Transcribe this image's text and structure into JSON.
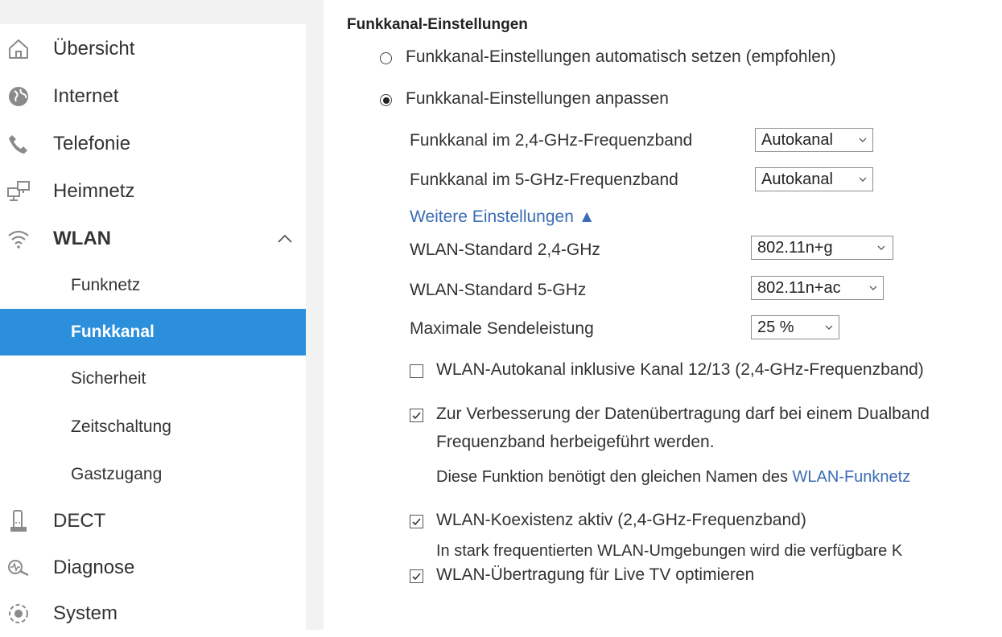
{
  "sidebar": {
    "items": [
      {
        "label": "Übersicht",
        "icon": "home-icon"
      },
      {
        "label": "Internet",
        "icon": "globe-icon"
      },
      {
        "label": "Telefonie",
        "icon": "phone-icon"
      },
      {
        "label": "Heimnetz",
        "icon": "network-icon"
      },
      {
        "label": "WLAN",
        "icon": "wifi-icon",
        "expanded": true
      },
      {
        "label": "DECT",
        "icon": "dect-phone-icon"
      },
      {
        "label": "Diagnose",
        "icon": "diagnose-icon"
      },
      {
        "label": "System",
        "icon": "system-icon"
      }
    ],
    "wlan_subitems": [
      {
        "label": "Funknetz"
      },
      {
        "label": "Funkkanal",
        "active": true
      },
      {
        "label": "Sicherheit"
      },
      {
        "label": "Zeitschaltung"
      },
      {
        "label": "Gastzugang"
      }
    ],
    "active_color": "#2b8fdc"
  },
  "content": {
    "section_title": "Funkkanal-Einstellungen",
    "radio_auto": {
      "label": "Funkkanal-Einstellungen automatisch setzen (empfohlen)",
      "checked": false
    },
    "radio_custom": {
      "label": "Funkkanal-Einstellungen anpassen",
      "checked": true
    },
    "channel_24": {
      "label": "Funkkanal im 2,4-GHz-Frequenzband",
      "value": "Autokanal"
    },
    "channel_5": {
      "label": "Funkkanal im 5-GHz-Frequenzband",
      "value": "Autokanal"
    },
    "more_settings": {
      "label": "Weitere Einstellungen ▲"
    },
    "standard_24": {
      "label": "WLAN-Standard 2,4-GHz",
      "value": "802.11n+g"
    },
    "standard_5": {
      "label": "WLAN-Standard 5-GHz",
      "value": "802.11n+ac"
    },
    "tx_power": {
      "label": "Maximale Sendeleistung",
      "value": "25 %"
    },
    "cb_autochannel": {
      "label": "WLAN-Autokanal inklusive Kanal 12/13 (2,4-GHz-Frequenzband)",
      "checked": false
    },
    "cb_band_steering": {
      "label_line1": "Zur Verbesserung der Datenübertragung darf bei einem Dualband",
      "label_line2": "Frequenzband herbeigeführt werden.",
      "note_prefix": "Diese Funktion benötigt den gleichen Namen des ",
      "note_link": "WLAN-Funknetz",
      "checked": true
    },
    "cb_coexistence": {
      "label": "WLAN-Koexistenz aktiv (2,4-GHz-Frequenzband)",
      "note": "In stark frequentierten WLAN-Umgebungen wird die verfügbare K",
      "checked": true
    },
    "cb_live_tv": {
      "label": "WLAN-Übertragung für Live TV optimieren",
      "checked": true
    },
    "link_color": "#3b6cb5"
  }
}
